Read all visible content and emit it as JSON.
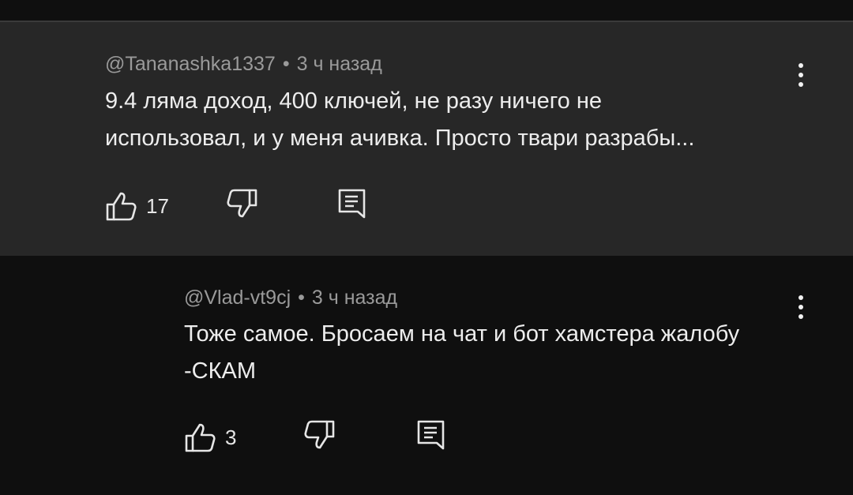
{
  "comments": [
    {
      "author": "@Tananashka1337",
      "separator": "•",
      "time": "3 ч назад",
      "text": "9.4 ляма доход, 400 ключей, не разу ничего не\nиспользовал, и у меня ачивка.  Просто твари разрабы...",
      "likes": "17",
      "icons": [
        "thumb-up-icon",
        "thumb-down-icon",
        "reply-icon",
        "more-vert-icon"
      ]
    },
    {
      "author": "@Vlad-vt9cj",
      "separator": "•",
      "time": "3 ч назад",
      "text": "Тоже самое. Бросаем на чат и бот хамстера жалобу\n-СКАМ",
      "likes": "3",
      "icons": [
        "thumb-up-icon",
        "thumb-down-icon",
        "reply-icon",
        "more-vert-icon"
      ]
    }
  ],
  "colors": {
    "background": "#0f0f0f",
    "highlighted_comment": "#272727",
    "text": "#ededed",
    "meta_text": "#9a9a9a"
  }
}
